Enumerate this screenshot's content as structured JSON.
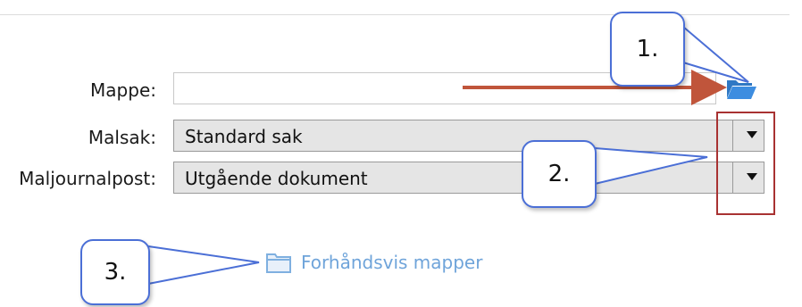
{
  "form": {
    "mappe_label": "Mappe:",
    "mappe_value": "",
    "malsak_label": "Malsak:",
    "malsak_value": "Standard sak",
    "maljournalpost_label": "Maljournalpost:",
    "maljournalpost_value": "Utgående dokument"
  },
  "preview": {
    "label": "Forhåndsvis mapper"
  },
  "callouts": {
    "one": "1.",
    "two": "2.",
    "three": "3."
  },
  "icons": {
    "folder_browse": "folder-open-icon",
    "preview": "folder-icon"
  },
  "colors": {
    "callout_border": "#4b6fd6",
    "arrow": "#c0553b",
    "highlight_box": "#a83232",
    "link_text": "#6fa4da",
    "folder_blue": "#2f78c4"
  }
}
